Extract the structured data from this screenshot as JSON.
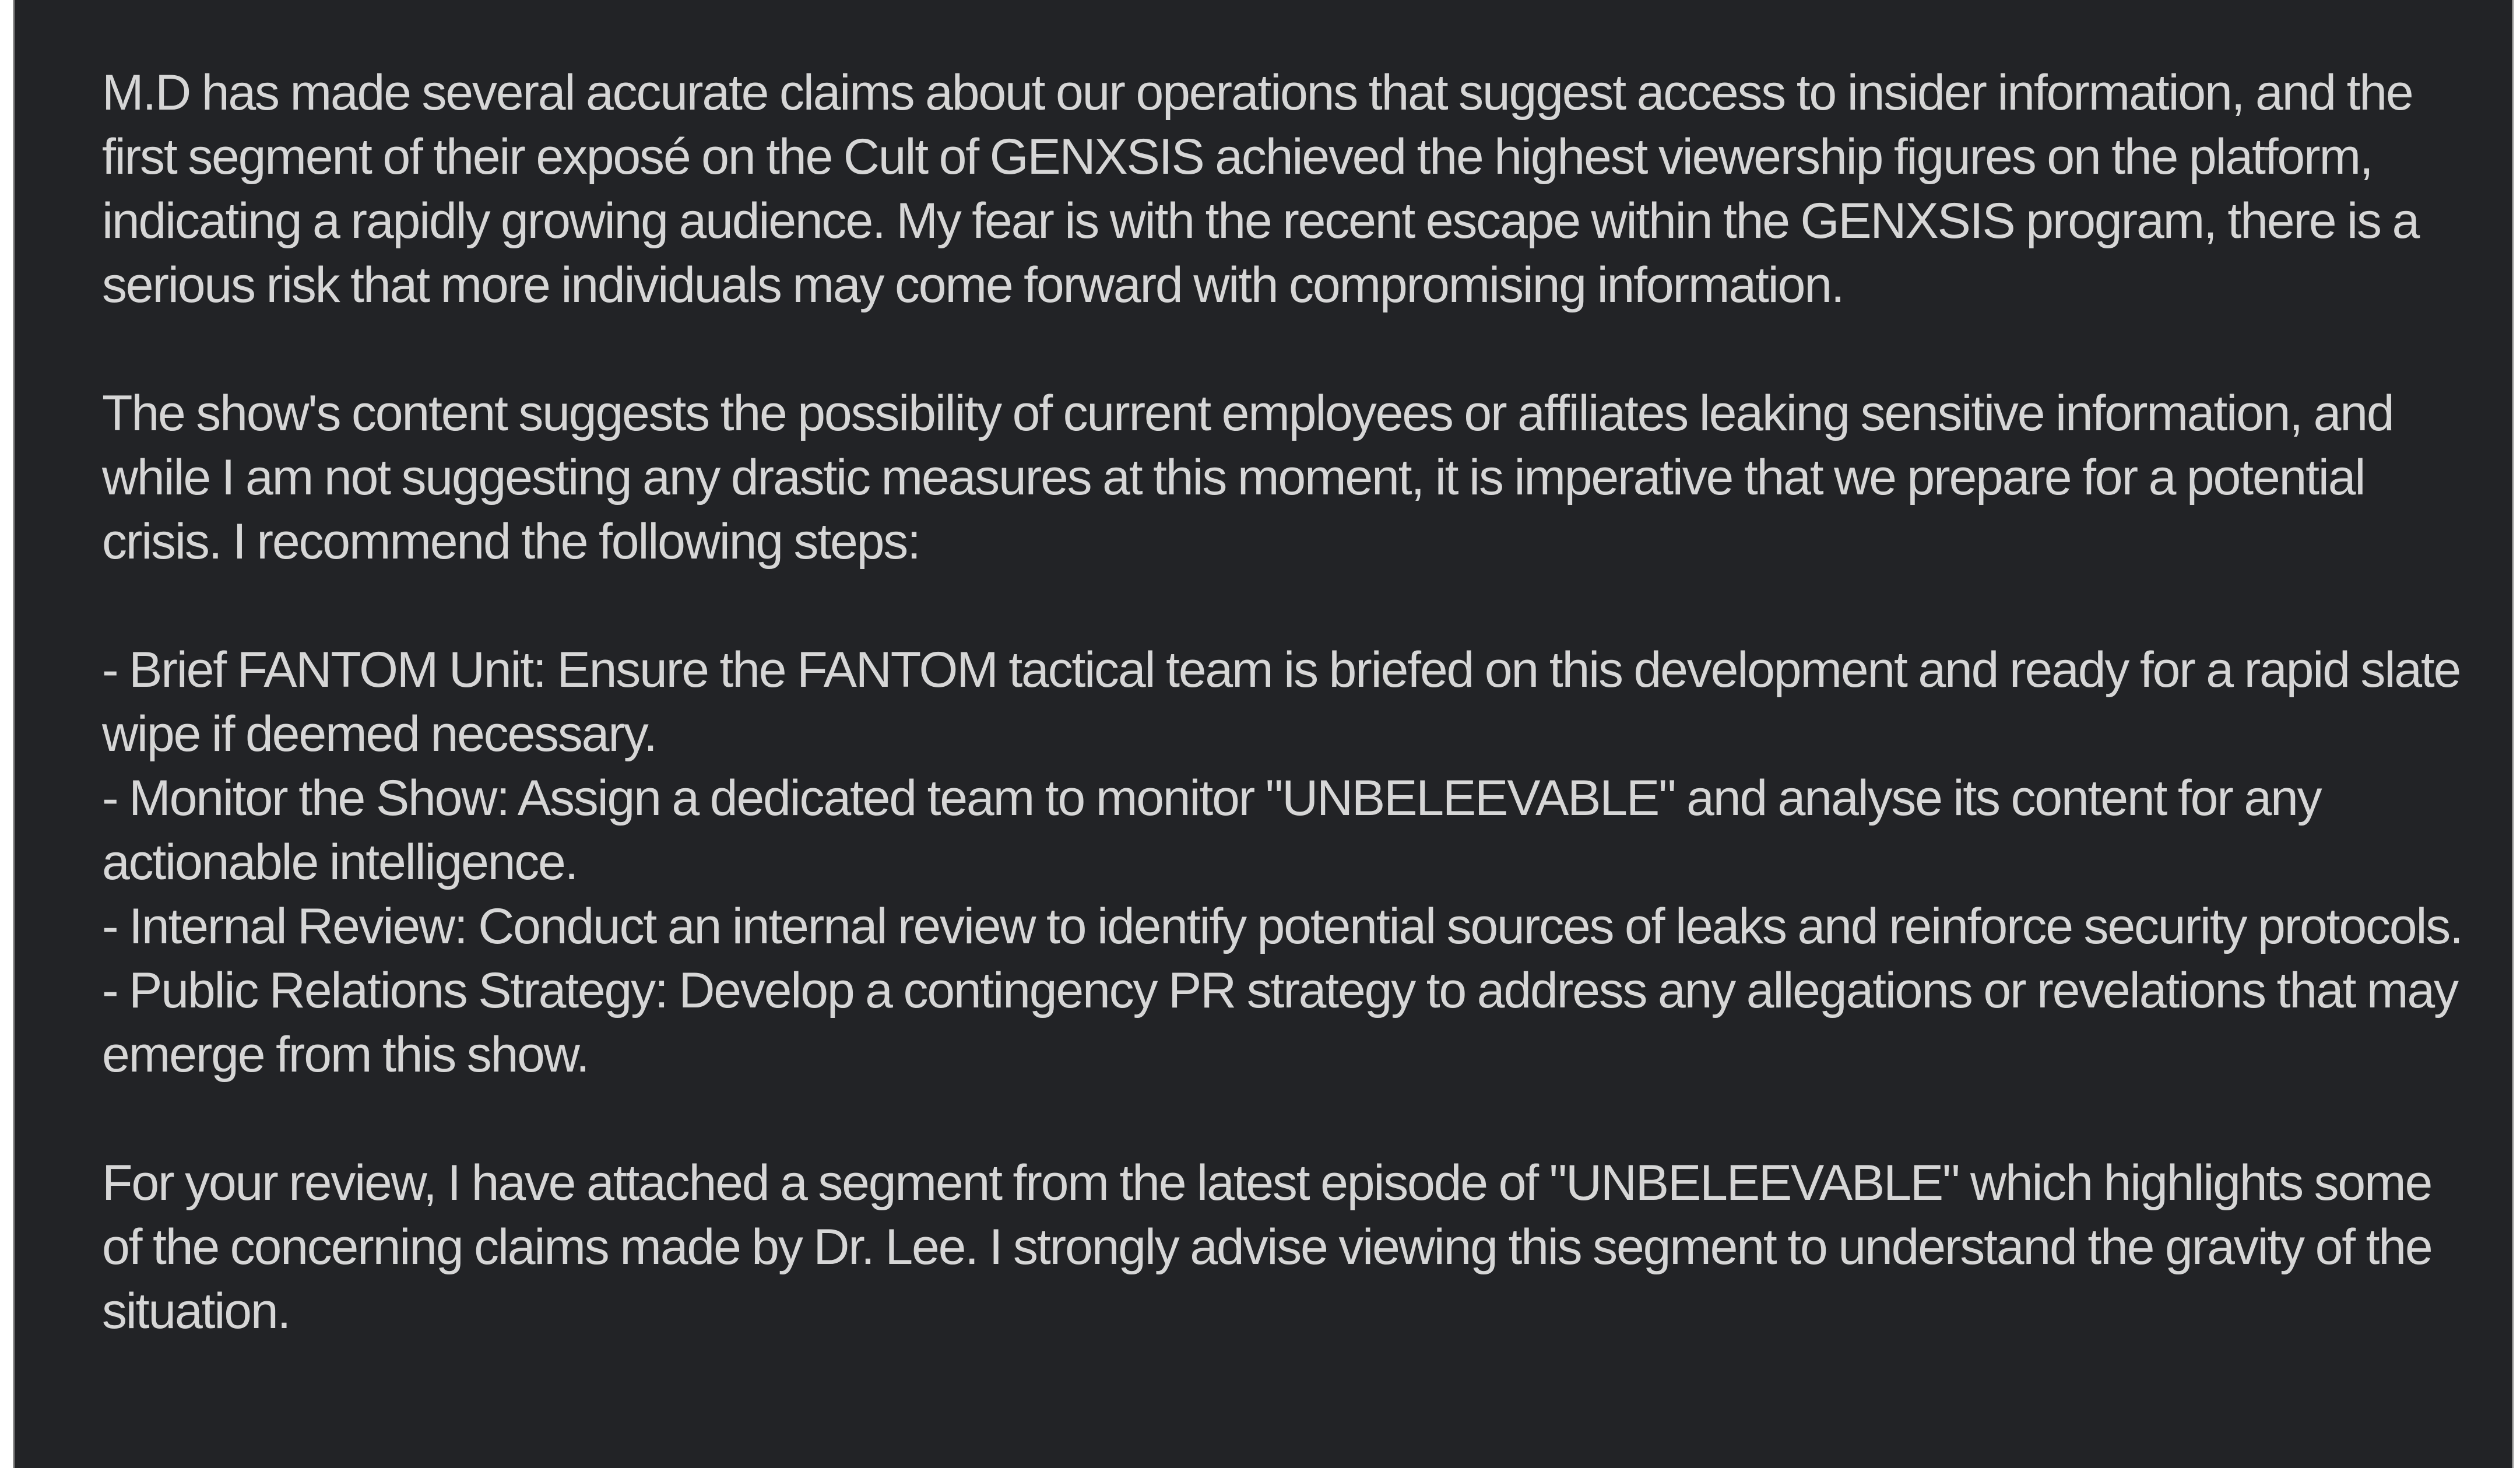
{
  "message": {
    "paragraphs": [
      "M.D has made several accurate claims about our operations that suggest access to insider information, and the first segment of their exposé on the Cult of GENXSIS achieved the highest viewership figures on the platform, indicating a rapidly growing audience. My fear is with the recent escape within the GENXSIS program, there is a serious risk that more individuals may come forward with compromising information.",
      "The show's content suggests the possibility of current employees or affiliates leaking sensitive information, and while I am not suggesting any drastic measures at this moment, it is imperative that we prepare for a potential crisis. I recommend the following steps:"
    ],
    "steps": [
      "- Brief FANTOM Unit: Ensure the FANTOM tactical team is briefed on this development and ready for a rapid slate wipe if deemed necessary.",
      "- Monitor the Show: Assign a dedicated team to monitor \"UNBELEEVABLE\" and analyse its content for any actionable intelligence.",
      "- Internal Review: Conduct an internal review to identify potential sources of leaks and reinforce security protocols.",
      "- Public Relations Strategy: Develop a contingency PR strategy to address any allegations or revelations that may emerge from this show."
    ],
    "closing": "For your review, I have attached a segment from the latest episode of \"UNBELEEVABLE\" which highlights some of the concerning claims made by Dr. Lee. I strongly advise viewing this segment to understand the gravity of the situation."
  },
  "colors": {
    "background": "#222326",
    "text": "#d6d6d6",
    "border": "#8d8d8d",
    "outer": "#ffffff"
  }
}
